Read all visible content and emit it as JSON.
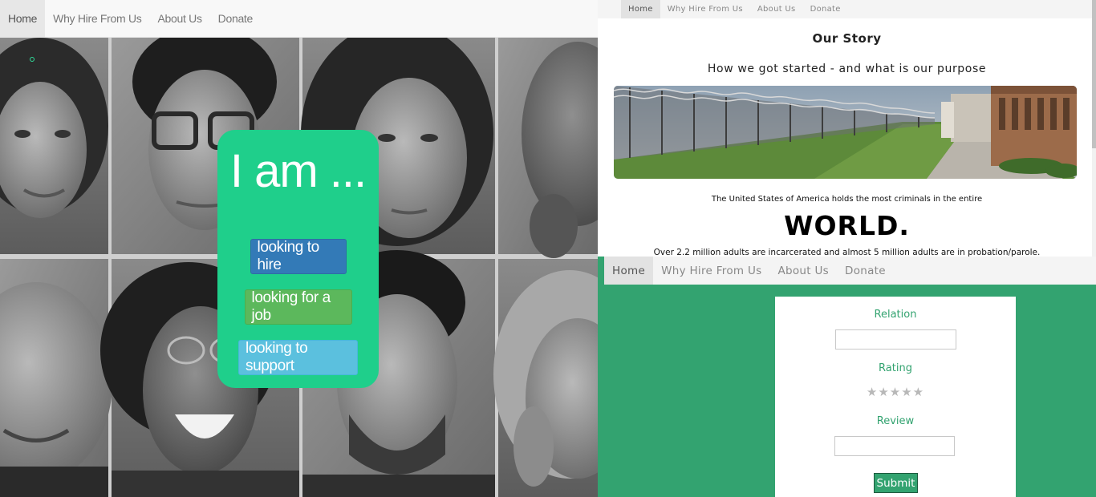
{
  "left_page": {
    "nav": [
      "Home",
      "Why Hire From Us",
      "About Us",
      "Donate"
    ],
    "cta": {
      "title": "I am ...",
      "buttons": [
        "looking to hire",
        "looking for a job",
        "looking to support"
      ],
      "colors": {
        "card": "#1fcf8b",
        "hire": "#337ab7",
        "job": "#5cb85c",
        "support": "#5bc0de"
      }
    },
    "background": "grayscale-portrait-grid"
  },
  "story_page": {
    "nav": [
      "Home",
      "Why Hire From Us",
      "About Us",
      "Donate"
    ],
    "title": "Our Story",
    "subtitle": "How we got started - and what is our purpose",
    "image": "prison-fence-photo",
    "line1": "The United States of America holds the most criminals in the entire",
    "emphasis": "WORLD.",
    "line2": "Over 2.2 million adults are incarcerated and almost 5 million adults are in probation/parole."
  },
  "review_page": {
    "nav": [
      "Home",
      "Why Hire From Us",
      "About Us",
      "Donate"
    ],
    "form": {
      "relation_label": "Relation",
      "relation_value": "",
      "rating_label": "Rating",
      "rating_stars": "★★★★★",
      "rating_value": 0,
      "review_label": "Review",
      "review_value": "",
      "submit_label": "Submit"
    },
    "accent": "#33a370"
  }
}
